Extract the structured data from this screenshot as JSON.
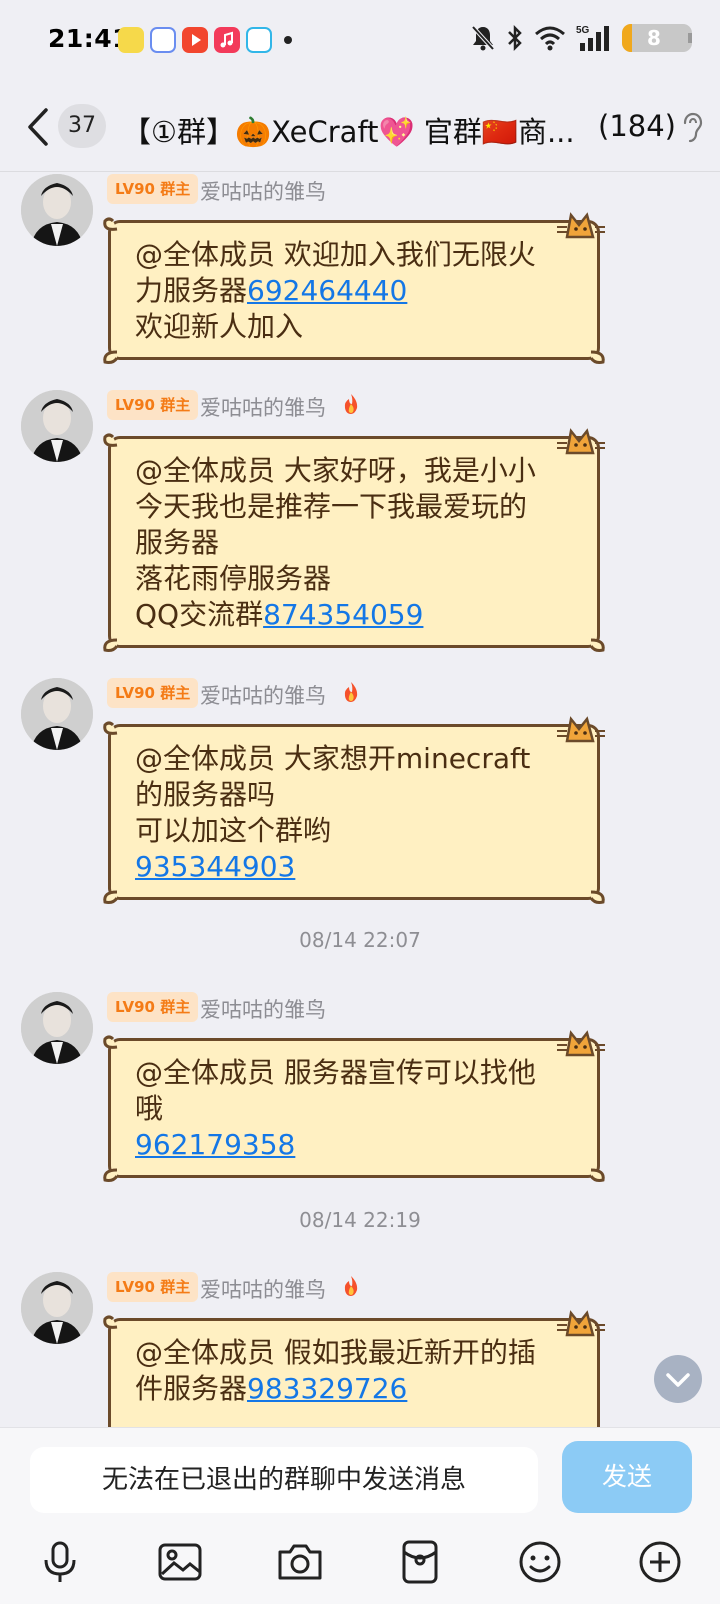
{
  "status_bar": {
    "time": "21:41",
    "app_icons": [
      "user-app-icon",
      "ai-app-icon",
      "video-app-icon",
      "music-app-icon",
      "score-app-icon"
    ],
    "battery": "8",
    "network": "5G"
  },
  "header": {
    "unread": "37",
    "title": "【①群】🎃XeCraft💖 官群🇨🇳商...",
    "member_count": "(184)"
  },
  "messages": [
    {
      "level": "LV90 群主",
      "nickname": "爱咕咕的雏鸟",
      "lines": [
        {
          "text": "@全体成员 欢迎加入我们无限火"
        },
        {
          "text": "力服务器",
          "link": "692464440"
        },
        {
          "text": "欢迎新人加入"
        }
      ]
    },
    {
      "level": "LV90 群主",
      "nickname": "爱咕咕的雏鸟",
      "lines": [
        {
          "text": "@全体成员 大家好呀，我是小小"
        },
        {
          "text": "今天我也是推荐一下我最爱玩的"
        },
        {
          "text": "服务器"
        },
        {
          "text": "落花雨停服务器"
        },
        {
          "text": "QQ交流群",
          "link": "874354059"
        }
      ]
    },
    {
      "level": "LV90 群主",
      "nickname": "爱咕咕的雏鸟",
      "lines": [
        {
          "text": "@全体成员 大家想开minecraft"
        },
        {
          "text": "的服务器吗"
        },
        {
          "text": "可以加这个群哟"
        },
        {
          "text": "",
          "link": "935344903"
        }
      ]
    },
    {
      "level": "LV90 群主",
      "nickname": "爱咕咕的雏鸟",
      "lines": [
        {
          "text": "@全体成员 服务器宣传可以找他"
        },
        {
          "text": "哦"
        },
        {
          "text": "",
          "link": "962179358"
        }
      ]
    },
    {
      "level": "LV90 群主",
      "nickname": "爱咕咕的雏鸟",
      "lines": [
        {
          "text": "@全体成员 假如我最近新开的插"
        },
        {
          "text": "件服务器",
          "link": "983329726"
        }
      ]
    }
  ],
  "timestamps": [
    "08/14 22:07",
    "08/14 22:19"
  ],
  "input": {
    "placeholder": "无法在已退出的群聊中发送消息",
    "send_label": "发送"
  },
  "toolbar": [
    "microphone-icon",
    "image-icon",
    "camera-icon",
    "red-packet-icon",
    "emoji-icon",
    "plus-icon"
  ],
  "colors": {
    "bubble_bg": "#fff0c2",
    "bubble_border": "#6b4a2a",
    "link": "#1477e6",
    "send_disabled": "#8ccbf5",
    "badge_bg": "#fde3c6",
    "badge_text": "#f47b16"
  }
}
